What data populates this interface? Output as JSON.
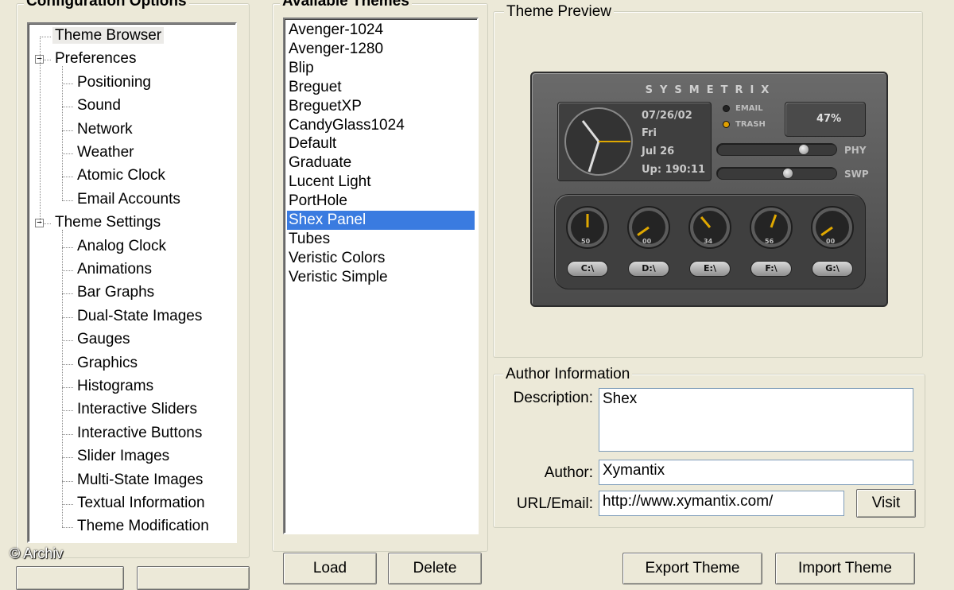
{
  "config": {
    "title": "Configuration Options",
    "tree": [
      {
        "label": "Theme Browser",
        "level": 0,
        "selected": true
      },
      {
        "label": "Preferences",
        "level": 0,
        "expander": "-"
      },
      {
        "label": "Positioning",
        "level": 1
      },
      {
        "label": "Sound",
        "level": 1
      },
      {
        "label": "Network",
        "level": 1
      },
      {
        "label": "Weather",
        "level": 1
      },
      {
        "label": "Atomic Clock",
        "level": 1
      },
      {
        "label": "Email Accounts",
        "level": 1
      },
      {
        "label": "Theme Settings",
        "level": 0,
        "expander": "-"
      },
      {
        "label": "Analog Clock",
        "level": 1
      },
      {
        "label": "Animations",
        "level": 1
      },
      {
        "label": "Bar Graphs",
        "level": 1
      },
      {
        "label": "Dual-State Images",
        "level": 1
      },
      {
        "label": "Gauges",
        "level": 1
      },
      {
        "label": "Graphics",
        "level": 1
      },
      {
        "label": "Histograms",
        "level": 1
      },
      {
        "label": "Interactive Sliders",
        "level": 1
      },
      {
        "label": "Interactive Buttons",
        "level": 1
      },
      {
        "label": "Slider Images",
        "level": 1
      },
      {
        "label": "Multi-State Images",
        "level": 1
      },
      {
        "label": "Textual Information",
        "level": 1
      },
      {
        "label": "Theme Modification",
        "level": 1
      }
    ]
  },
  "themes": {
    "title": "Available Themes",
    "items": [
      "Avenger-1024",
      "Avenger-1280",
      "Blip",
      "Breguet",
      "BreguetXP",
      "CandyGlass1024",
      "Default",
      "Graduate",
      "Lucent Light",
      "PortHole",
      "Shex Panel",
      "Tubes",
      "Veristic Colors",
      "Veristic Simple"
    ],
    "selected": "Shex Panel",
    "buttons": {
      "load": "Load",
      "delete": "Delete"
    }
  },
  "preview": {
    "title": "Theme Preview",
    "skin": {
      "name": "SYSMETRIX",
      "date": "07/26/02",
      "day": "Fri",
      "month_day": "Jul 26",
      "uptime": "Up: 190:11",
      "email_label": "EMAIL",
      "trash_label": "TRASH",
      "percent": "47%",
      "phy_label": "PHY",
      "swp_label": "SWP",
      "phy_level": 0.75,
      "swp_level": 0.6,
      "gauges": [
        {
          "drive": "C:\\",
          "value": "50"
        },
        {
          "drive": "D:\\",
          "value": "00"
        },
        {
          "drive": "E:\\",
          "value": "34"
        },
        {
          "drive": "F:\\",
          "value": "56"
        },
        {
          "drive": "G:\\",
          "value": "00"
        }
      ]
    }
  },
  "author": {
    "title": "Author Information",
    "description_label": "Description:",
    "description": "Shex",
    "author_label": "Author:",
    "author": "Xymantix",
    "url_label": "URL/Email:",
    "url": "http://www.xymantix.com/",
    "visit_label": "Visit"
  },
  "bottom_buttons": {
    "export": "Export Theme",
    "import": "Import Theme"
  },
  "watermark": "© Archiv"
}
